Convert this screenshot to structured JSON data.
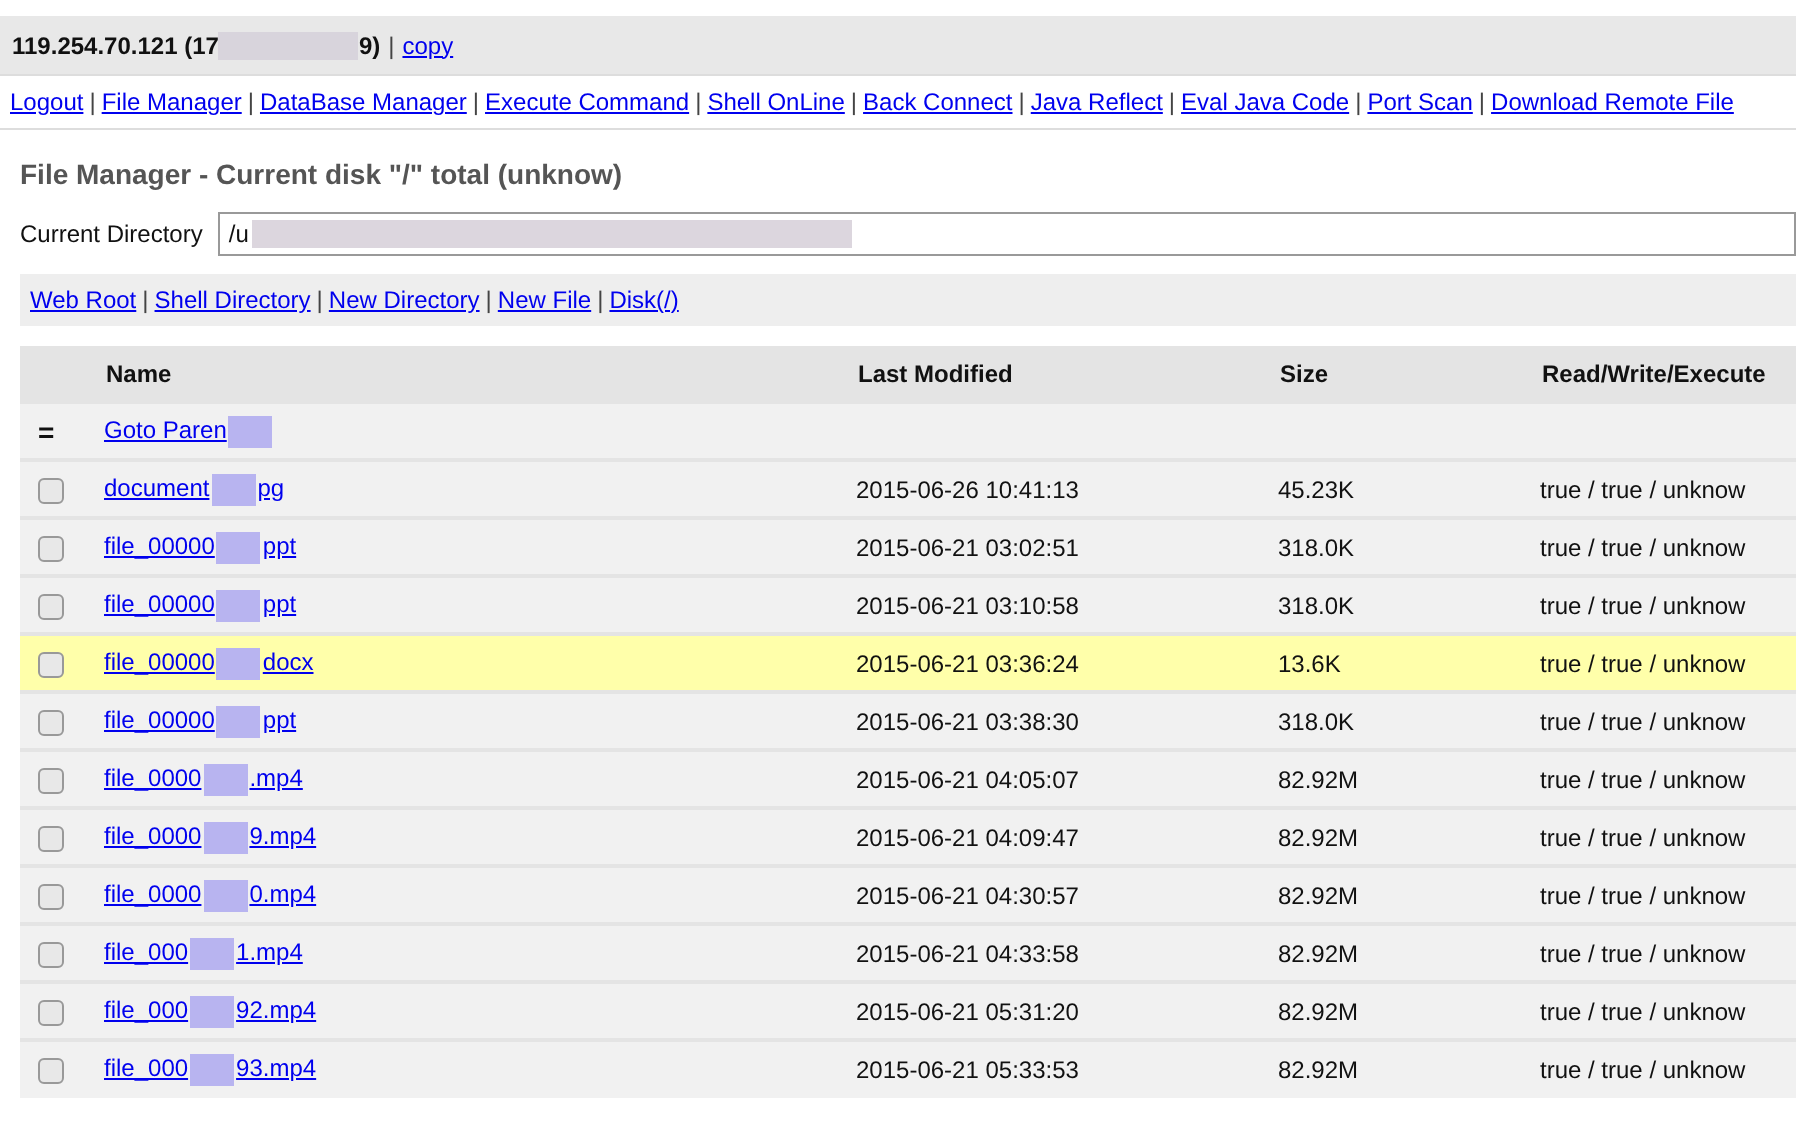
{
  "header": {
    "host_start": "119.254.70.121 (17",
    "host_end": "9)",
    "separator": "|",
    "copy_link": "copy"
  },
  "nav_separator": "|",
  "shortcut_separator": "|",
  "nav": [
    "Logout",
    "File Manager",
    "DataBase Manager",
    "Execute Command",
    "Shell OnLine",
    "Back Connect",
    "Java Reflect",
    "Eval Java Code",
    "Port Scan",
    "Download Remote File"
  ],
  "title": "File Manager - Current disk \"/\" total (unknow)",
  "directory": {
    "label": "Current Directory",
    "value": "/u"
  },
  "shortcuts": [
    "Web Root",
    "Shell Directory",
    "New Directory",
    "New File",
    "Disk(/)"
  ],
  "table": {
    "columns": [
      "Name",
      "Last Modified",
      "Size",
      "Read/Write/Execute"
    ],
    "parent": {
      "marker": "=",
      "name_start": "Goto Paren"
    },
    "rows": [
      {
        "name_start": "document",
        "name_end": "pg",
        "modified": "2015-06-26 10:41:13",
        "size": "45.23K",
        "rwx": "true / true / unknow",
        "checked": false,
        "highlighted": false
      },
      {
        "name_start": "file_00000",
        "name_end": "ppt",
        "modified": "2015-06-21 03:02:51",
        "size": "318.0K",
        "rwx": "true / true / unknow",
        "checked": false,
        "highlighted": false
      },
      {
        "name_start": "file_00000",
        "name_end": "ppt",
        "modified": "2015-06-21 03:10:58",
        "size": "318.0K",
        "rwx": "true / true / unknow",
        "checked": false,
        "highlighted": false
      },
      {
        "name_start": "file_00000",
        "name_end": "docx",
        "modified": "2015-06-21 03:36:24",
        "size": "13.6K",
        "rwx": "true / true / unknow",
        "checked": false,
        "highlighted": true
      },
      {
        "name_start": "file_00000",
        "name_end": "ppt",
        "modified": "2015-06-21 03:38:30",
        "size": "318.0K",
        "rwx": "true / true / unknow",
        "checked": false,
        "highlighted": false
      },
      {
        "name_start": "file_0000",
        "name_end": ".mp4",
        "modified": "2015-06-21 04:05:07",
        "size": "82.92M",
        "rwx": "true / true / unknow",
        "checked": false,
        "highlighted": false
      },
      {
        "name_start": "file_0000",
        "name_end": "9.mp4",
        "modified": "2015-06-21 04:09:47",
        "size": "82.92M",
        "rwx": "true / true / unknow",
        "checked": false,
        "highlighted": false
      },
      {
        "name_start": "file_0000",
        "name_end": "0.mp4",
        "modified": "2015-06-21 04:30:57",
        "size": "82.92M",
        "rwx": "true / true / unknow",
        "checked": false,
        "highlighted": false
      },
      {
        "name_start": "file_000",
        "name_end": "1.mp4",
        "modified": "2015-06-21 04:33:58",
        "size": "82.92M",
        "rwx": "true / true / unknow",
        "checked": false,
        "highlighted": false
      },
      {
        "name_start": "file_000",
        "name_end": "92.mp4",
        "modified": "2015-06-21 05:31:20",
        "size": "82.92M",
        "rwx": "true / true / unknow",
        "checked": false,
        "highlighted": false
      },
      {
        "name_start": "file_000",
        "name_end": "93.mp4",
        "modified": "2015-06-21 05:33:53",
        "size": "82.92M",
        "rwx": "true / true / unknow",
        "checked": false,
        "highlighted": false
      }
    ]
  }
}
